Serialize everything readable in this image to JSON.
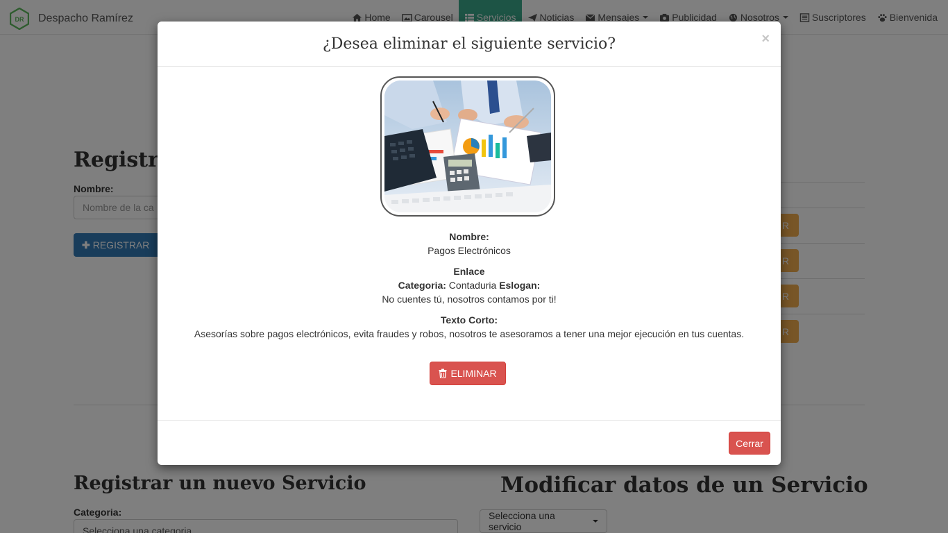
{
  "brand": {
    "name": "Despacho Ramírez",
    "logo_text": "DR",
    "logo_color": "#5cb85c"
  },
  "nav": {
    "items": [
      {
        "label": "Home",
        "icon": "home-icon"
      },
      {
        "label": "Carousel",
        "icon": "image-icon"
      },
      {
        "label": "Servicios",
        "icon": "list-icon",
        "active": true
      },
      {
        "label": "Noticias",
        "icon": "send-icon"
      },
      {
        "label": "Mensajes",
        "icon": "envelope-icon",
        "dropdown": true
      },
      {
        "label": "Publicidad",
        "icon": "camera-icon"
      },
      {
        "label": "Nosotros",
        "icon": "globe-icon",
        "dropdown": true
      },
      {
        "label": "Suscriptores",
        "icon": "list-alt-icon"
      },
      {
        "label": "Bienvenida",
        "icon": "paw-icon"
      }
    ],
    "active_color": "#3aa88a"
  },
  "background": {
    "register_category_heading": "Registrar",
    "name_label": "Nombre:",
    "name_placeholder": "Nombre de la ca",
    "register_button": "REGISTRAR",
    "warning_button_text": "R",
    "register_service_heading": "Registrar un nuevo Servicio",
    "category_label": "Categoria:",
    "category_select": "Selecciona una categoria",
    "modify_service_heading": "Modificar datos de un Servicio",
    "select_service": "Selecciona una servicio"
  },
  "modal": {
    "title": "¿Desea eliminar el siguiente servicio?",
    "close_symbol": "×",
    "image_icon": "accounting-photo",
    "name_label": "Nombre:",
    "name_value": "Pagos Electrónicos",
    "link_label": "Enlace",
    "category_label": "Categoria:",
    "category_value": "Contaduria",
    "slogan_label": "Eslogan:",
    "slogan_value": "No cuentes tú, nosotros contamos por ti!",
    "short_text_label": "Texto Corto:",
    "short_text_value": "Asesorías sobre pagos electrónicos, evita fraudes y robos, nosotros te asesoramos a tener una mejor ejecución en tus cuentas.",
    "delete_button": "ELIMINAR",
    "close_button": "Cerrar",
    "danger_color": "#d9534f"
  }
}
